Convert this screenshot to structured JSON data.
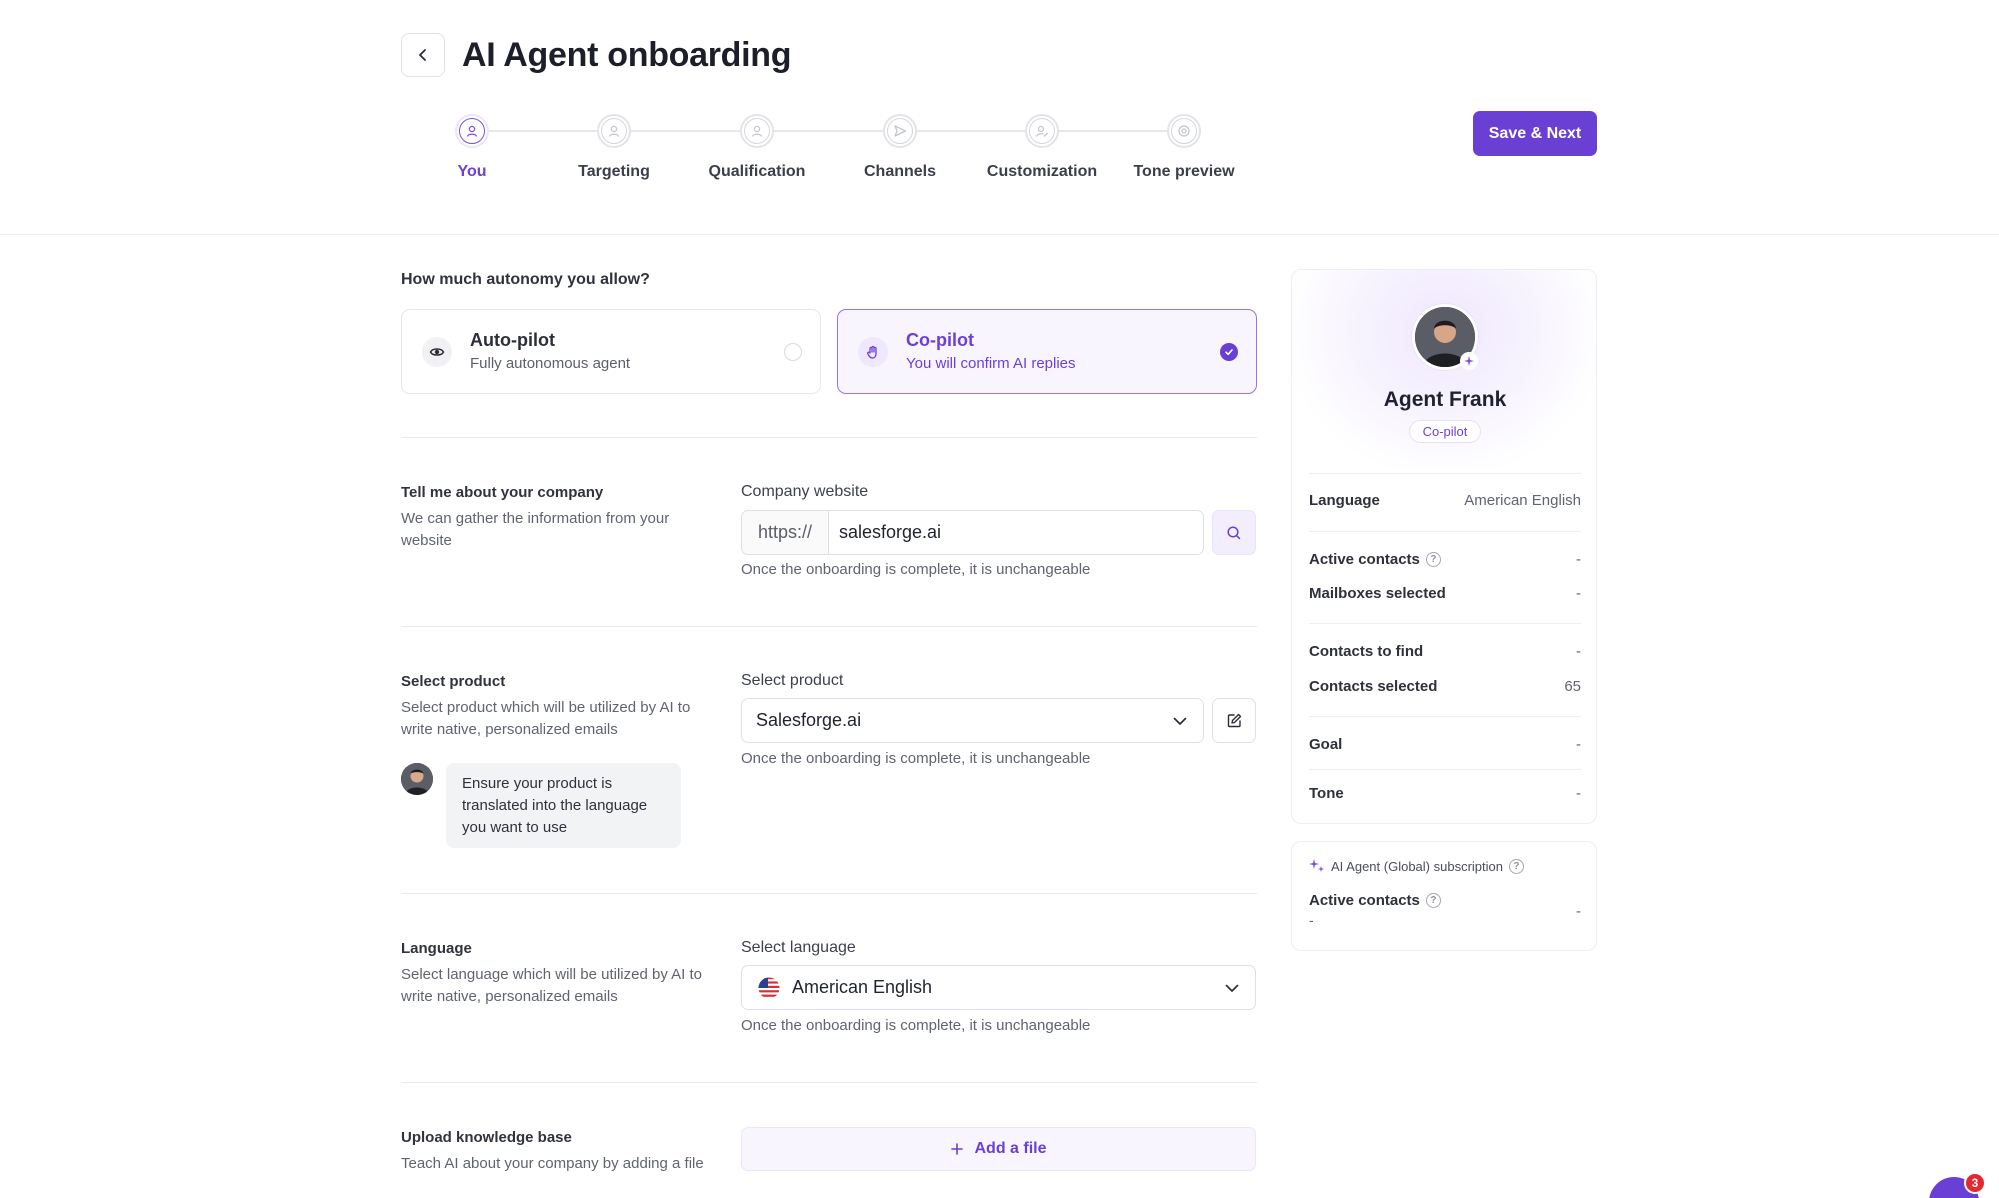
{
  "header": {
    "title": "AI Agent onboarding",
    "save_label": "Save & Next"
  },
  "steps": [
    {
      "label": "You",
      "active": true,
      "icon": "user-icon"
    },
    {
      "label": "Targeting",
      "active": false,
      "icon": "user-icon"
    },
    {
      "label": "Qualification",
      "active": false,
      "icon": "user-icon"
    },
    {
      "label": "Channels",
      "active": false,
      "icon": "send-icon"
    },
    {
      "label": "Customization",
      "active": false,
      "icon": "user-edit-icon"
    },
    {
      "label": "Tone preview",
      "active": false,
      "icon": "target-icon"
    }
  ],
  "autonomy": {
    "question": "How much autonomy you allow?",
    "options": [
      {
        "title": "Auto-pilot",
        "subtitle": "Fully autonomous agent",
        "icon": "eye-icon",
        "selected": false
      },
      {
        "title": "Co-pilot",
        "subtitle": "You will confirm AI replies",
        "icon": "hand-icon",
        "selected": true
      }
    ]
  },
  "company": {
    "title": "Tell me about your company",
    "description": "We can gather the information from your website",
    "field_label": "Company website",
    "prefix": "https://",
    "value": "salesforge.ai",
    "hint": "Once the onboarding is complete, it is unchangeable"
  },
  "product": {
    "title": "Select product",
    "description": "Select product which will be utilized by AI to write native, personalized emails",
    "field_label": "Select product",
    "value": "Salesforge.ai",
    "hint": "Once the onboarding is complete, it is unchangeable",
    "tip": "Ensure your product is translated into the language you want to use"
  },
  "language": {
    "title": "Language",
    "description": "Select language which will be utilized by AI to write native, personalized emails",
    "field_label": "Select language",
    "value": "American English",
    "hint": "Once the onboarding is complete, it is unchangeable"
  },
  "knowledge": {
    "title": "Upload knowledge base",
    "description": "Teach AI about your company by adding a file",
    "button": "Add a file"
  },
  "agent_card": {
    "name": "Agent Frank",
    "mode": "Co-pilot",
    "language_label": "Language",
    "language_value": "American English",
    "active_contacts_label": "Active contacts",
    "active_contacts_value": "-",
    "mailboxes_label": "Mailboxes selected",
    "mailboxes_value": "-",
    "contacts_find_label": "Contacts to find",
    "contacts_find_value": "-",
    "contacts_selected_label": "Contacts selected",
    "contacts_selected_value": "65",
    "goal_label": "Goal",
    "goal_value": "-",
    "tone_label": "Tone",
    "tone_value": "-"
  },
  "subscription": {
    "title": "AI Agent (Global) subscription",
    "active_label": "Active contacts",
    "active_value": "-",
    "active_sub": "-"
  },
  "chat": {
    "count": "3"
  },
  "colors": {
    "accent": "#6a3fd4",
    "accent_text": "#6e3fd6",
    "alert": "#e5282f"
  }
}
